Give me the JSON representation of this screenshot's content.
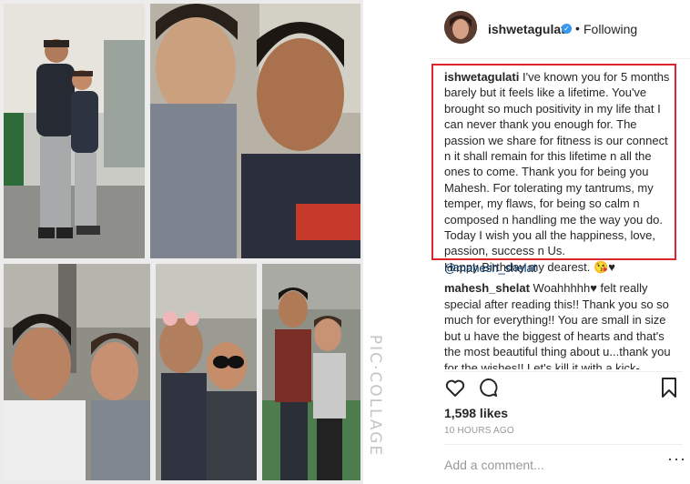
{
  "post": {
    "username": "ishwetagulati",
    "follow_status": "Following",
    "separator": "•",
    "caption_text": " I've known you for 5 months barely but it feels like a lifetime. You've brought so much positivity in my life that I can never thank you enough for. The passion we share for fitness is our connect n it shall remain for this lifetime n all the ones to come. Thank you for being you Mahesh. For tolerating my tantrums, my temper, my flaws, for being so calm n composed n handling me the way you do. Today I wish you all the happiness, love, passion, success n Us.",
    "caption_last_line": "Happy Birthday my dearest. 😘♥",
    "mention": "@mahesh_shelat",
    "likes": "1,598 likes",
    "time_ago": "10 HOURS AGO",
    "add_comment_placeholder": "Add a comment...",
    "more_label": "···"
  },
  "comment": {
    "username": "mahesh_shelat",
    "text": " Woahhhhh♥ felt really special after reading this!! Thank you so so much for everything!! You are small in size but u have the biggest of hearts and that's the most beautiful thing about u...thank you for the wishes!! Let's kill it with a kick-"
  },
  "watermark": "PIC·COLLAGE",
  "icons": [
    "heart-icon",
    "comment-icon",
    "bookmark-icon",
    "verified-badge-icon"
  ],
  "colors": {
    "highlight_box": "#d9262c",
    "verified": "#3897f0",
    "mention": "#003569"
  }
}
